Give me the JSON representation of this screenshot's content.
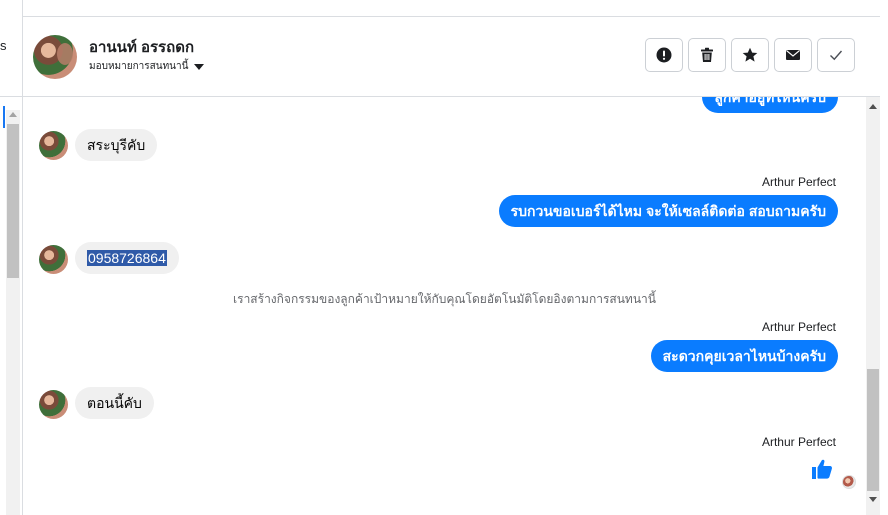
{
  "left_panel": {
    "truncated_text": "s"
  },
  "header": {
    "contact_name": "อานนท์ อรรถดก",
    "assign_label": "มอบหมายการสนทนานี้",
    "actions": [
      {
        "name": "spam-button",
        "icon": "exclamation-icon"
      },
      {
        "name": "delete-button",
        "icon": "trash-icon"
      },
      {
        "name": "star-button",
        "icon": "star-icon"
      },
      {
        "name": "unread-button",
        "icon": "envelope-icon"
      },
      {
        "name": "done-button",
        "icon": "check-icon"
      }
    ]
  },
  "messages": {
    "top_partial_out": "ลูกค้าอยู่ที่ไหนครับ",
    "in_1": "สระบุรีคับ",
    "sender_1": "Arthur Perfect",
    "out_1": "รบกวนขอเบอร์ได้ไหม จะให้เซลล์ติดต่อ สอบถามครับ",
    "in_2": "0958726864",
    "system_note": "เราสร้างกิจกรรมของลูกค้าเป้าหมายให้กับคุณโดยอัตโนมัติโดยอิงตามการสนทนานี้",
    "sender_2": "Arthur Perfect",
    "out_2": "สะดวกคุยเวลาไหนบ้างครับ",
    "in_3": "ตอนนี้คับ",
    "sender_3": "Arthur Perfect"
  },
  "colors": {
    "outgoing_bubble": "#0a7cff",
    "incoming_bubble": "#f0f0f0",
    "selection": "#2f5aa8"
  }
}
